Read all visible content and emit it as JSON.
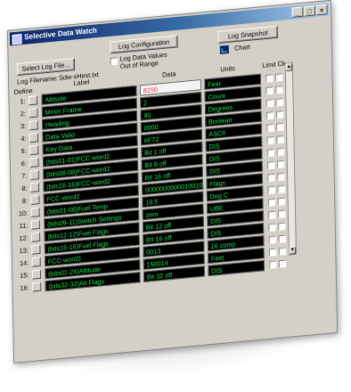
{
  "window": {
    "title": "Selective Data Watch"
  },
  "titlebar_buttons": {
    "minimize": "_",
    "maximize": "□",
    "close": "×"
  },
  "toolbar": {
    "select_log_file": "Select Log File...",
    "log_configuration": "Log Configuration",
    "log_snapshot": "Log Snapshot",
    "chart_label": "Chart",
    "log_data_values_line1": "Log Data Values",
    "log_data_values_line2": "Out of Range",
    "log_filename_label": "Log Filename:",
    "log_filename_value": "Sdw-sHest.txt"
  },
  "columns": {
    "define": "Define",
    "label": "Label",
    "data": "Data",
    "units": "Units",
    "limit_check": "Limit Ck"
  },
  "rows": [
    {
      "num": "1:",
      "label": "Altitude",
      "data": "8250",
      "units": "Feet",
      "alert": true
    },
    {
      "num": "2:",
      "label": "Minor Frame",
      "data": "2",
      "units": "Count"
    },
    {
      "num": "3:",
      "label": "Heading",
      "data": "90",
      "units": "Degrees"
    },
    {
      "num": "4:",
      "label": "Data Valid",
      "data": "0000",
      "units": "Boolean"
    },
    {
      "num": "5:",
      "label": "Key Data",
      "data": "6F72",
      "units": "ASCII"
    },
    {
      "num": "6:",
      "label": "(bits01-01)FCC-word2",
      "data": "Bit 1 off",
      "units": "DIS"
    },
    {
      "num": "7:",
      "label": "(bits08-08)FCC-word2",
      "data": "Bit 8 off",
      "units": "DIS"
    },
    {
      "num": "8:",
      "label": "(bits16-16)FCC-word2",
      "data": "Bit 16 off",
      "units": "DIS"
    },
    {
      "num": "9:",
      "label": "FCC-word2",
      "data": "0000000000010010",
      "units": "Flags"
    },
    {
      "num": "10:",
      "label": "(bits01-08)Fuel Temp",
      "data": "19.5",
      "units": "Deg C"
    },
    {
      "num": "11:",
      "label": "(bits09-11)Switch Settings",
      "data": "zero",
      "units": "UBE"
    },
    {
      "num": "12:",
      "label": "(bits12-12)Fuel Flags",
      "data": "Bit 12 off",
      "units": "DIS"
    },
    {
      "num": "13:",
      "label": "(bits16-16)Fuel Flags",
      "data": "Bit 16 off",
      "units": "DIS"
    },
    {
      "num": "14:",
      "label": "FCC-word3",
      "data": "0013",
      "units": "16 comp"
    },
    {
      "num": "15:",
      "label": "(bits01-24)Altitude",
      "data": "150014",
      "units": "Feet"
    },
    {
      "num": "16:",
      "label": "(bits32-32)Alt Flags",
      "data": "Bit 32 off",
      "units": "DIS"
    }
  ],
  "scrollbar": {
    "up_arrow": "▲",
    "down_arrow": "▼"
  },
  "colors": {
    "cell_background": "#000000",
    "cell_text": "#1fdc4f",
    "alert_text": "#ff3030",
    "title_bar": "#0a246a"
  }
}
